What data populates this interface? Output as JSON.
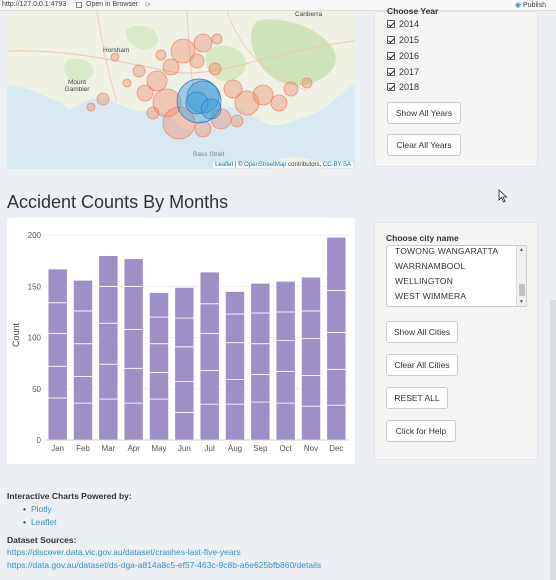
{
  "browser": {
    "url": "http://127.0.0.1:4793",
    "open_in_browser": "Open in Browser",
    "publish": "Publish"
  },
  "map": {
    "labels": {
      "canberra": "Canberra",
      "horsham": "Horsham",
      "mount_gambier": "Mount Gambier",
      "bass_strait": "Bass Strait"
    },
    "attribution_leaflet": "Leaflet",
    "attribution_sep": " | © ",
    "attribution_osm": "OpenStreetMap",
    "attribution_contrib": " contributors, ",
    "attribution_license": "CC-BY-SA"
  },
  "year_panel": {
    "label": "Choose Year",
    "years": [
      "2014",
      "2015",
      "2016",
      "2017",
      "2018"
    ],
    "show_all": "Show All Years",
    "clear_all": "Clear All Years"
  },
  "section_title": "Accident Counts By Months",
  "chart_data": {
    "type": "bar",
    "stacked": true,
    "categories": [
      "Jan",
      "Feb",
      "Mar",
      "Apr",
      "May",
      "Jun",
      "Jul",
      "Aug",
      "Sep",
      "Oct",
      "Nov",
      "Dec"
    ],
    "totals": [
      167,
      156,
      180,
      177,
      144,
      149,
      164,
      145,
      153,
      155,
      159,
      198
    ],
    "segments": [
      [
        41,
        31,
        32,
        30,
        33
      ],
      [
        36,
        26,
        32,
        32,
        30
      ],
      [
        40,
        34,
        40,
        36,
        30
      ],
      [
        36,
        34,
        38,
        42,
        27
      ],
      [
        40,
        26,
        28,
        26,
        24
      ],
      [
        27,
        30,
        34,
        28,
        30
      ],
      [
        35,
        33,
        36,
        29,
        31
      ],
      [
        35,
        24,
        36,
        28,
        22
      ],
      [
        37,
        27,
        30,
        30,
        29
      ],
      [
        36,
        31,
        30,
        28,
        30
      ],
      [
        33,
        30,
        36,
        27,
        33
      ],
      [
        34,
        35,
        36,
        41,
        52
      ]
    ],
    "ylabel": "Count",
    "xlabel": "",
    "ylim": [
      0,
      205
    ],
    "yticks": [
      0,
      50,
      100,
      150,
      200
    ],
    "bar_color": "#9e8fc7",
    "grid": true
  },
  "city_panel": {
    "label": "Choose city name",
    "items": [
      "TOWONG  WANGARATTA",
      "WARRNAMBOOL",
      "WELLINGTON",
      "WEST WIMMERA"
    ],
    "show_all": "Show All Cities",
    "clear_all": "Clear All Cities",
    "reset_all": "RESET ALL",
    "help": "Click for Help"
  },
  "footer": {
    "powered_by": "Interactive Charts Powered by:",
    "libraries": [
      "Plotly",
      "Leaflet"
    ],
    "sources_label": "Dataset Sources:",
    "sources": [
      "https://discover.data.vic.gov.au/dataset/crashes-last-five-years",
      "https://data.gov.au/dataset/ds-dga-a814a8c5-ef57-463c-9c8b-a6e625bfb860/details"
    ]
  },
  "colors": {
    "page_bg": "#ecf0f5",
    "panel_bg": "#f5f5f5",
    "link": "#3c8dbc",
    "bar": "#9e8fc7",
    "accident_marker": "#f07a5a",
    "accident_cluster": "#3b9ddc"
  },
  "icons": {
    "open_in_browser": "external-window-icon",
    "refresh": "refresh-icon",
    "publish": "publish-icon",
    "cursor": "mouse-pointer-icon"
  }
}
